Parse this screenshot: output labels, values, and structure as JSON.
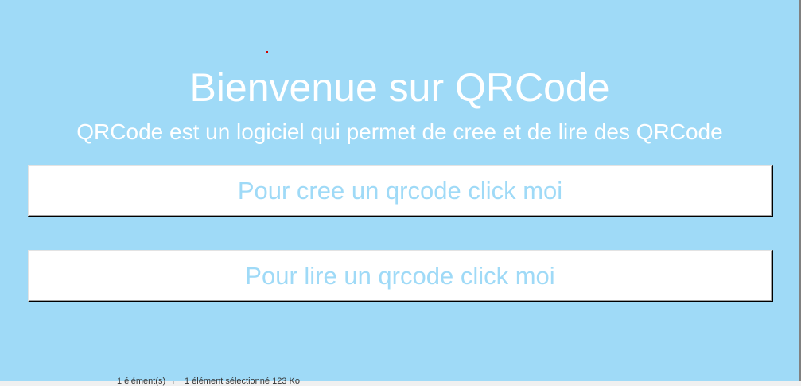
{
  "welcome": {
    "title": "Bienvenue sur QRCode",
    "subtitle": "QRCode est un logiciel qui permet de cree et de lire des QRCode"
  },
  "buttons": {
    "create_label": "Pour cree un qrcode click moi",
    "read_label": "Pour lire un qrcode click moi"
  },
  "statusbar": {
    "item_count": "1 élément(s)",
    "selection": "1 élément sélectionné  123 Ko"
  },
  "colors": {
    "background": "#9fdaf7",
    "button_text": "#9fdaf7"
  }
}
